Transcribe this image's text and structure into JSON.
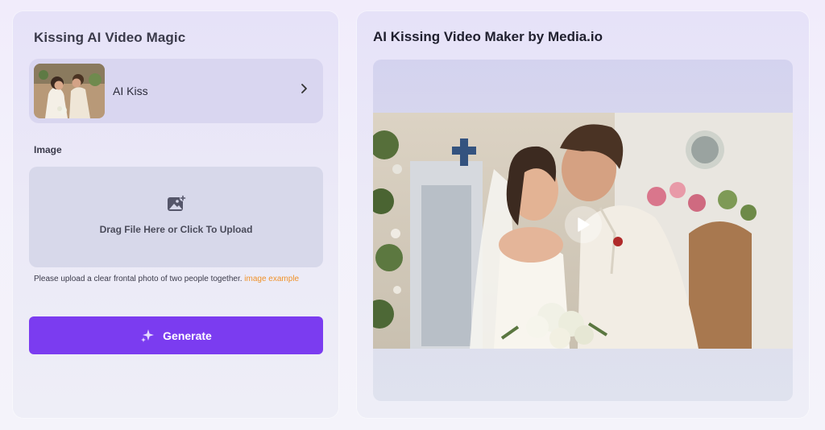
{
  "left_panel": {
    "title": "Kissing AI Video Magic",
    "template": {
      "label": "AI Kiss"
    },
    "image_section_label": "Image",
    "upload": {
      "text": "Drag File Here or Click To Upload"
    },
    "hint": {
      "text": "Please upload a clear frontal photo of two people together. ",
      "link": "image example"
    },
    "generate_label": "Generate"
  },
  "right_panel": {
    "title": "AI Kissing Video Maker by Media.io"
  },
  "colors": {
    "accent": "#7b3cf0",
    "link": "#f0922a"
  }
}
